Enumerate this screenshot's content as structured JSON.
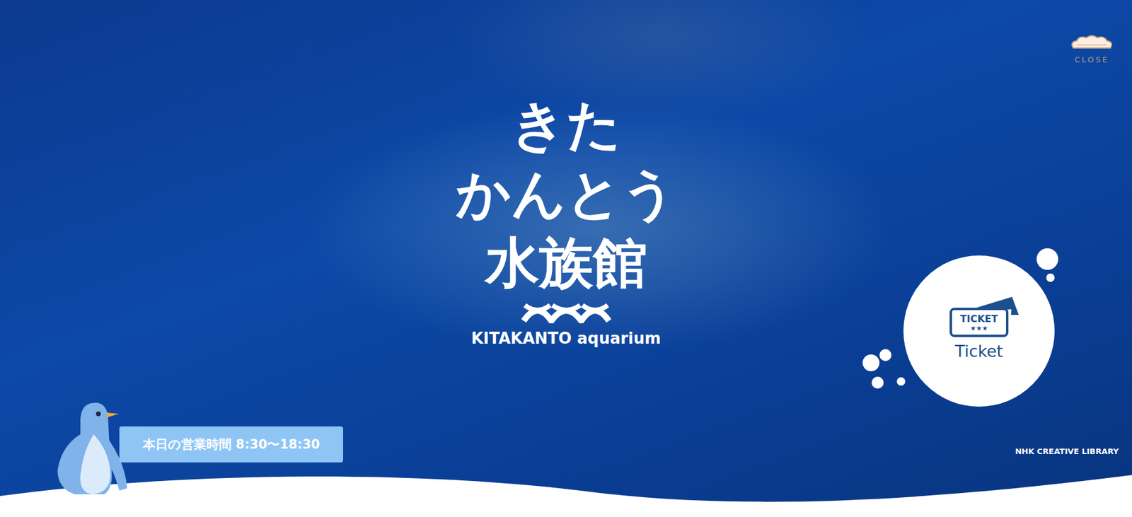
{
  "logo": {
    "line1": "きた",
    "line2": "かんとう",
    "line3": "水族館",
    "english": "KITAKANTO aquarium"
  },
  "close": {
    "label": "CLOSE"
  },
  "ticket": {
    "icon_text": "TICKET",
    "stars": "★★★",
    "label": "Ticket"
  },
  "hours": {
    "text": "本日の営業時間 8:30〜18:30"
  },
  "credit": "NHK CREATIVE LIBRARY"
}
